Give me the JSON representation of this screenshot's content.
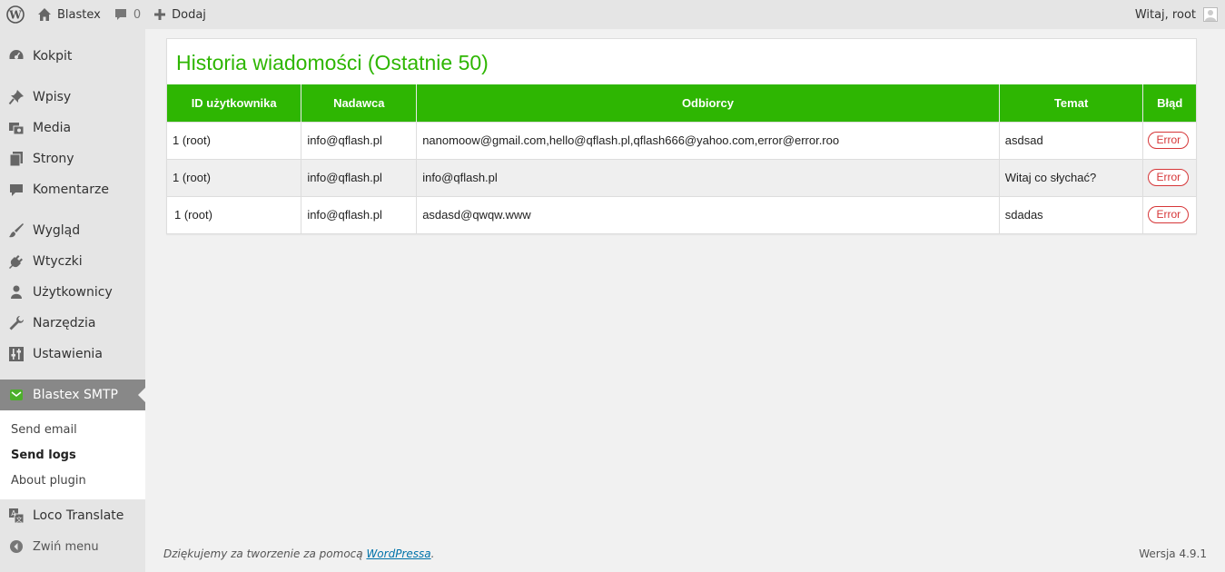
{
  "adminbar": {
    "site_name": "Blastex",
    "comments_count": "0",
    "add_new": "Dodaj",
    "greeting": "Witaj, root"
  },
  "sidebar": {
    "items": [
      {
        "label": "Kokpit",
        "icon": "dashboard-icon"
      },
      {
        "label": "Wpisy",
        "icon": "pin-icon"
      },
      {
        "label": "Media",
        "icon": "media-icon"
      },
      {
        "label": "Strony",
        "icon": "page-icon"
      },
      {
        "label": "Komentarze",
        "icon": "comment-icon"
      },
      {
        "label": "Wygląd",
        "icon": "brush-icon"
      },
      {
        "label": "Wtyczki",
        "icon": "plug-icon"
      },
      {
        "label": "Użytkownicy",
        "icon": "user-icon"
      },
      {
        "label": "Narzędzia",
        "icon": "wrench-icon"
      },
      {
        "label": "Ustawienia",
        "icon": "settings-icon"
      },
      {
        "label": "Blastex SMTP",
        "icon": "mail-icon"
      },
      {
        "label": "Loco Translate",
        "icon": "translate-icon"
      }
    ],
    "submenu": [
      {
        "label": "Send email"
      },
      {
        "label": "Send logs"
      },
      {
        "label": "About plugin"
      }
    ],
    "collapse_label": "Zwiń menu"
  },
  "main": {
    "title": "Historia wiadomości (Ostatnie 50)",
    "columns": [
      "ID użytkownika",
      "Nadawca",
      "Odbiorcy",
      "Temat",
      "Błąd"
    ],
    "rows": [
      {
        "user": "1 (root)",
        "from": "info@qflash.pl",
        "to": "nanomoow@gmail.com,hello@qflash.pl,qflash666@yahoo.com,error@error.roo",
        "subject": "asdsad",
        "error": "Error"
      },
      {
        "user": "1 (root)",
        "from": "info@qflash.pl",
        "to": "info@qflash.pl",
        "subject": "Witaj co słychać?",
        "error": "Error"
      },
      {
        "user": "1 (root)",
        "from": "info@qflash.pl",
        "to": "asdasd@qwqw.www",
        "subject": "sdadas",
        "error": "Error"
      }
    ]
  },
  "footer": {
    "thanks_prefix": "Dziękujemy za tworzenie za pomocą ",
    "thanks_link": "WordPressa",
    "thanks_suffix": ".",
    "version": "Wersja 4.9.1"
  },
  "colors": {
    "accent_green": "#2eb602",
    "error_red": "#d63638",
    "sidebar_bg": "#e5e5e5",
    "current_menu_bg": "#888888"
  }
}
